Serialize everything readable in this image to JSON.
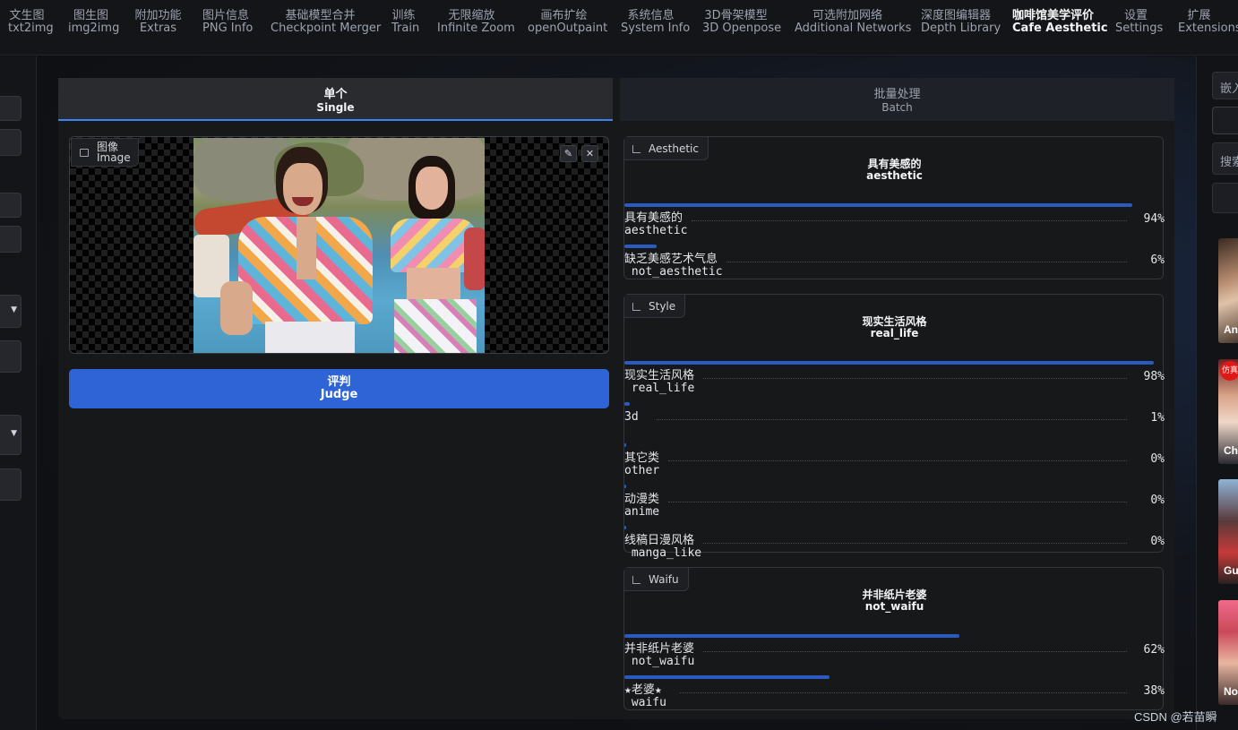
{
  "nav_tabs": [
    {
      "zh": "文生图",
      "en": "txt2img"
    },
    {
      "zh": "图生图",
      "en": "img2img"
    },
    {
      "zh": "附加功能",
      "en": "Extras"
    },
    {
      "zh": "图片信息",
      "en": "PNG Info"
    },
    {
      "zh": "基础模型合并",
      "en": "Checkpoint Merger"
    },
    {
      "zh": "训练",
      "en": "Train"
    },
    {
      "zh": "无限缩放",
      "en": "Infinite Zoom"
    },
    {
      "zh": "画布扩绘",
      "en": "openOutpaint"
    },
    {
      "zh": "系统信息",
      "en": "System Info"
    },
    {
      "zh": "3D骨架模型",
      "en": "3D Openpose"
    },
    {
      "zh": "可选附加网络",
      "en": "Additional Networks"
    },
    {
      "zh": "深度图编辑器",
      "en": "Depth Library"
    },
    {
      "zh": "咖啡馆美学评价",
      "en": "Cafe Aesthetic",
      "active": true
    },
    {
      "zh": "设置",
      "en": "Settings"
    },
    {
      "zh": "扩展",
      "en": "Extensions"
    }
  ],
  "mode_tabs": {
    "single": {
      "zh": "单个",
      "en": "Single"
    },
    "batch": {
      "zh": "批量处理",
      "en": "Batch"
    }
  },
  "image_panel": {
    "label_zh": "图像",
    "label_en": "Image",
    "edit_icon": "pencil-icon",
    "close_icon": "close-icon"
  },
  "judge_button": {
    "zh": "评判",
    "en": "Judge"
  },
  "results": [
    {
      "label": "Aesthetic",
      "title_zh": "具有美感的",
      "title_en": "aesthetic",
      "rows": [
        {
          "zh": "具有美感的",
          "en": "aesthetic",
          "pct": "94%",
          "value": 0.94
        },
        {
          "zh": "缺乏美感艺术气息",
          "en": " not_aesthetic",
          "pct": "6%",
          "value": 0.06
        }
      ]
    },
    {
      "label": "Style",
      "title_zh": "现实生活风格",
      "title_en": "real_life",
      "rows": [
        {
          "zh": "现实生活风格",
          "en": " real_life",
          "pct": "98%",
          "value": 0.98
        },
        {
          "zh": "3d",
          "en": "",
          "pct": "1%",
          "value": 0.01
        },
        {
          "zh": "其它类",
          "en": "other",
          "pct": "0%",
          "value": 0.002
        },
        {
          "zh": "动漫类",
          "en": "anime",
          "pct": "0%",
          "value": 0.002
        },
        {
          "zh": "线稿日漫风格",
          "en": " manga_like",
          "pct": "0%",
          "value": 0.002
        }
      ]
    },
    {
      "label": "Waifu",
      "title_zh": "并非纸片老婆",
      "title_en": "not_waifu",
      "rows": [
        {
          "zh": "并非纸片老婆",
          "en": " not_waifu",
          "pct": "62%",
          "value": 0.62
        },
        {
          "zh": "★老婆★",
          "en": " waifu",
          "pct": "38%",
          "value": 0.38
        }
      ]
    }
  ],
  "right_panel": {
    "tab_fragment": "嵌入",
    "search_placeholder": "搜索",
    "thumbs": [
      {
        "caption": "An",
        "badge": ""
      },
      {
        "caption": "Chi",
        "badge": "仿真"
      },
      {
        "caption": "Gu",
        "badge": ""
      },
      {
        "caption": "No",
        "badge": ""
      }
    ]
  },
  "watermark": "CSDN @若苗瞬",
  "colors": {
    "accent": "#2f64d6",
    "bar": "#2c5bbf",
    "tab_underline": "#3b82f6"
  }
}
